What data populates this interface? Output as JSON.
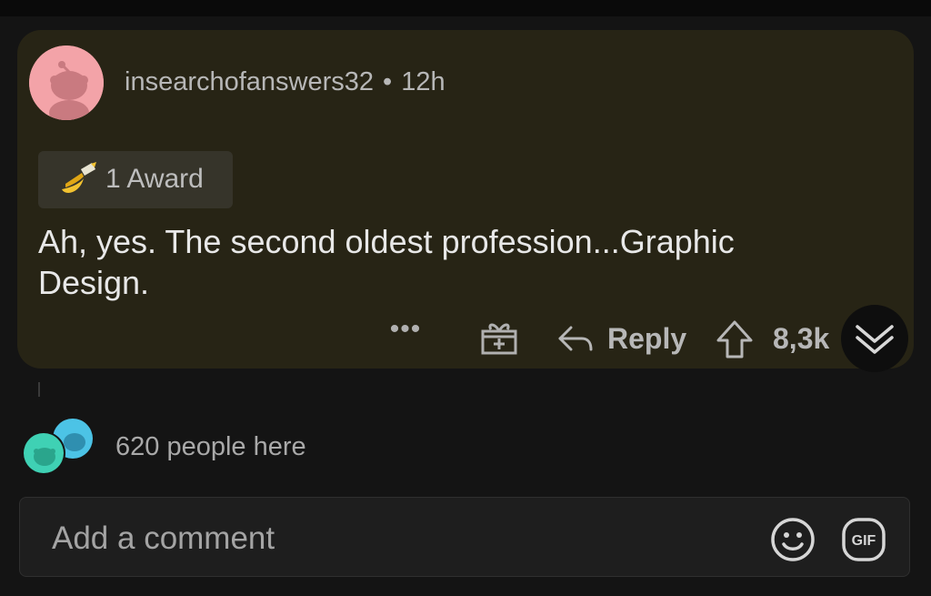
{
  "post": {
    "author": "insearchofanswers32",
    "separator": "•",
    "age": "12h",
    "award": {
      "label": "1 Award",
      "icon": "banana-icon"
    },
    "body": "Ah, yes. The second oldest profession...Graphic Design.",
    "actions": {
      "more_label": "•••",
      "reply_label": "Reply",
      "vote_count": "8,3k"
    }
  },
  "presence": {
    "text": "620 people here"
  },
  "composer": {
    "placeholder": "Add a comment",
    "gif_label": "GIF"
  },
  "colors": {
    "card_background": "#272415",
    "page_background": "#141414",
    "avatar_pink": "#f3a3a8",
    "avatar_teal": "#3fd1b4",
    "avatar_cyan": "#4cc3e6"
  }
}
